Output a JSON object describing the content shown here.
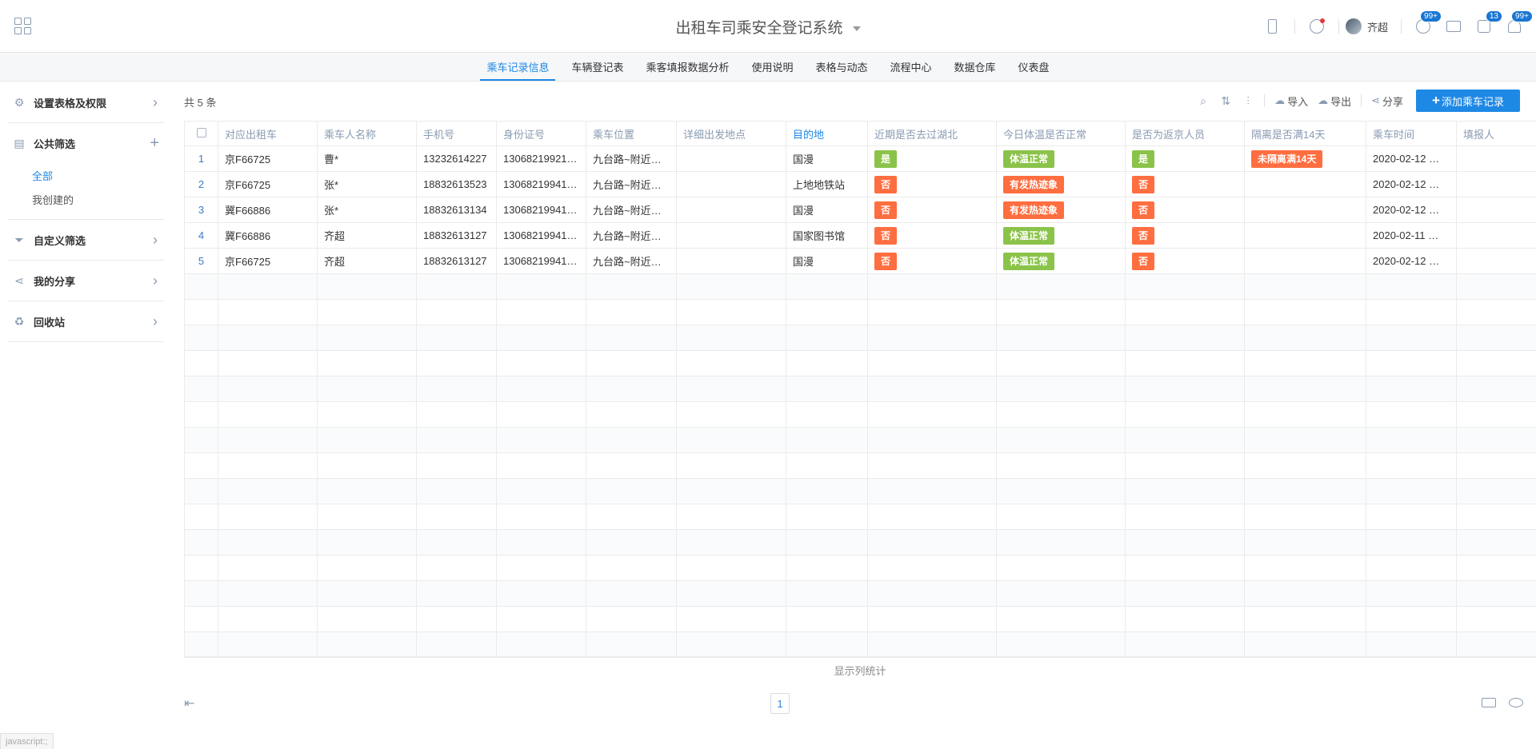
{
  "app": {
    "title": "出租车司乘安全登记系统"
  },
  "header": {
    "user_name": "齐超",
    "badges": {
      "ring": "99+",
      "stack": "13",
      "bell": "99+"
    }
  },
  "tabs": [
    {
      "label": "乘车记录信息"
    },
    {
      "label": "车辆登记表"
    },
    {
      "label": "乘客填报数据分析"
    },
    {
      "label": "使用说明"
    },
    {
      "label": "表格与动态"
    },
    {
      "label": "流程中心"
    },
    {
      "label": "数据仓库"
    },
    {
      "label": "仪表盘"
    }
  ],
  "sidebar": {
    "settings": "设置表格及权限",
    "public_filter": "公共筛选",
    "filter_all": "全部",
    "filter_mine": "我创建的",
    "custom_filter": "自定义筛选",
    "my_share": "我的分享",
    "recycle": "回收站"
  },
  "toolbar": {
    "count": "共 5 条",
    "import": "导入",
    "export": "导出",
    "share": "分享",
    "add": "添加乘车记录"
  },
  "table": {
    "columns": [
      "对应出租车",
      "乘车人名称",
      "手机号",
      "身份证号",
      "乘车位置",
      "详细出发地点",
      "目的地",
      "近期是否去过湖北",
      "今日体温是否正常",
      "是否为返京人员",
      "隔离是否满14天",
      "乘车时间",
      "填报人"
    ],
    "rows": [
      {
        "idx": "1",
        "car": "京F66725",
        "name": "曹*",
        "phone": "13232614227",
        "id": "13068219921…",
        "loc": "九台路~附近，…",
        "detail": "",
        "dest": "国漫",
        "hubei": "是",
        "temp": "体温正常",
        "back": "是",
        "iso": "未隔离满14天",
        "time": "2020-02-12 …",
        "reporter": ""
      },
      {
        "idx": "2",
        "car": "京F66725",
        "name": "张*",
        "phone": "18832613523",
        "id": "13068219941…",
        "loc": "九台路~附近，…",
        "detail": "",
        "dest": "上地地铁站",
        "hubei": "否",
        "temp": "有发热迹象",
        "back": "否",
        "iso": "",
        "time": "2020-02-12 …",
        "reporter": ""
      },
      {
        "idx": "3",
        "car": "冀F66886",
        "name": "张*",
        "phone": "18832613134",
        "id": "13068219941…",
        "loc": "九台路~附近，…",
        "detail": "",
        "dest": "国漫",
        "hubei": "否",
        "temp": "有发热迹象",
        "back": "否",
        "iso": "",
        "time": "2020-02-12 …",
        "reporter": ""
      },
      {
        "idx": "4",
        "car": "冀F66886",
        "name": "齐超",
        "phone": "18832613127",
        "id": "13068219941…",
        "loc": "九台路~附近，…",
        "detail": "",
        "dest": "国家图书馆",
        "hubei": "否",
        "temp": "体温正常",
        "back": "否",
        "iso": "",
        "time": "2020-02-11 …",
        "reporter": ""
      },
      {
        "idx": "5",
        "car": "京F66725",
        "name": "齐超",
        "phone": "18832613127",
        "id": "13068219941…",
        "loc": "九台路~附近，…",
        "detail": "",
        "dest": "国漫",
        "hubei": "否",
        "temp": "体温正常",
        "back": "否",
        "iso": "",
        "time": "2020-02-12 …",
        "reporter": ""
      }
    ],
    "tag_colors": {
      "是": "green",
      "否": "orange",
      "体温正常": "green",
      "有发热迹象": "orange",
      "未隔离满14天": "orange"
    }
  },
  "footer": {
    "col_stats": "显示列统计",
    "page": "1",
    "status": "javascript:;"
  }
}
